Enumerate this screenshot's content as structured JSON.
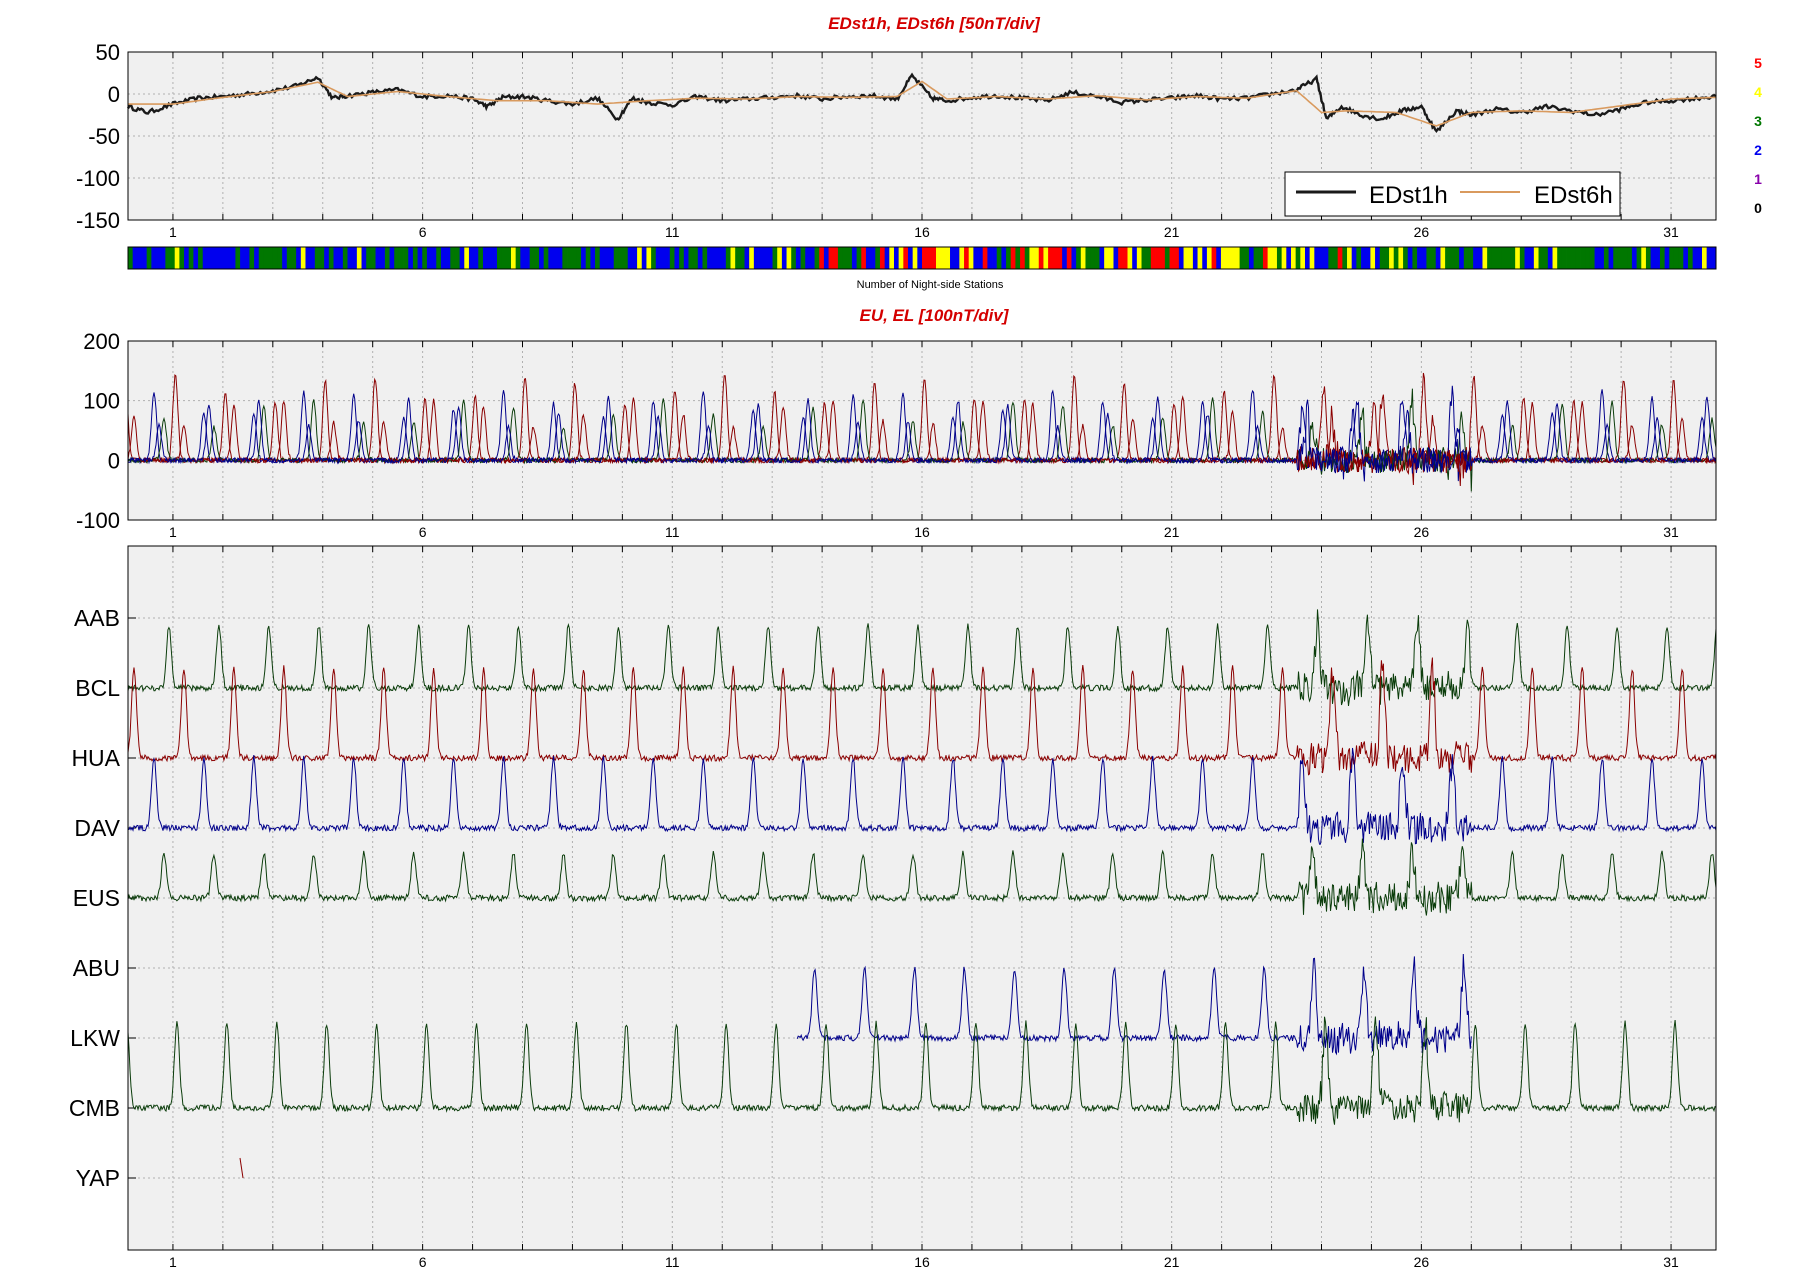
{
  "chart_data": [
    {
      "type": "line",
      "title": "EDst1h, EDst6h [50nT/div]",
      "ylim": [
        -150,
        50
      ],
      "yticks": [
        50,
        0,
        -50,
        -100,
        -150
      ],
      "xlim": [
        0.1,
        31.9
      ],
      "xticks": [
        1,
        6,
        11,
        16,
        21,
        26,
        31
      ],
      "grid": true,
      "legend": {
        "placement": "bottom-right",
        "entries": [
          "EDst1h",
          "EDst6h"
        ]
      },
      "series": [
        {
          "name": "EDst1h",
          "color": "#1a1a1a",
          "x": [
            0.1,
            0.5,
            1.0,
            1.5,
            2.0,
            2.5,
            3.0,
            3.5,
            3.9,
            4.2,
            4.5,
            5.0,
            5.5,
            6.0,
            6.5,
            7.0,
            7.3,
            7.6,
            8.0,
            8.5,
            9.0,
            9.5,
            9.9,
            10.2,
            10.5,
            11.0,
            11.5,
            12.0,
            12.5,
            13.0,
            13.5,
            14.0,
            14.5,
            15.0,
            15.5,
            15.8,
            16.2,
            16.5,
            17.0,
            17.5,
            18.0,
            18.5,
            19.0,
            19.5,
            20.0,
            20.5,
            21.0,
            21.5,
            22.0,
            22.5,
            23.0,
            23.5,
            23.9,
            24.1,
            24.4,
            24.8,
            25.2,
            25.6,
            26.0,
            26.3,
            26.7,
            27.0,
            27.5,
            28.0,
            28.5,
            29.0,
            29.5,
            30.0,
            30.5,
            31.0,
            31.5,
            31.9
          ],
          "y": [
            -15,
            -22,
            -12,
            -5,
            -3,
            0,
            4,
            10,
            20,
            -5,
            -2,
            2,
            5,
            -3,
            -2,
            -6,
            -15,
            -4,
            -3,
            -8,
            -12,
            -5,
            -30,
            -5,
            -10,
            -13,
            -3,
            -8,
            -6,
            -4,
            -2,
            -6,
            -3,
            -2,
            -6,
            22,
            -5,
            -8,
            -4,
            -2,
            -5,
            -8,
            2,
            -3,
            -10,
            -7,
            -5,
            -2,
            -6,
            -5,
            0,
            5,
            18,
            -30,
            -15,
            -25,
            -30,
            -20,
            -15,
            -45,
            -20,
            -25,
            -18,
            -22,
            -15,
            -20,
            -25,
            -18,
            -10,
            -8,
            -5,
            -3
          ]
        },
        {
          "name": "EDst6h",
          "color": "#d99a5e",
          "x": [
            0.1,
            1.0,
            2.0,
            3.0,
            3.9,
            4.5,
            5.5,
            6.5,
            7.5,
            8.5,
            9.5,
            10.5,
            11.5,
            12.5,
            13.5,
            14.5,
            15.5,
            16.0,
            16.5,
            17.5,
            18.5,
            19.5,
            20.5,
            21.5,
            22.5,
            23.5,
            24.0,
            24.5,
            25.5,
            26.3,
            27.0,
            28.0,
            29.0,
            30.0,
            31.0,
            31.9
          ],
          "y": [
            -12,
            -12,
            -4,
            3,
            14,
            -3,
            3,
            -3,
            -8,
            -8,
            -12,
            -8,
            -5,
            -6,
            -3,
            -4,
            -3,
            15,
            -6,
            -3,
            -6,
            -2,
            -7,
            -3,
            -5,
            4,
            -22,
            -20,
            -22,
            -38,
            -22,
            -20,
            -22,
            -14,
            -6,
            -4
          ]
        }
      ],
      "band": {
        "label": "Number of Night-side Stations",
        "key": [
          {
            "value": "5",
            "color": "#ff0000"
          },
          {
            "value": "4",
            "color": "#ffff00"
          },
          {
            "value": "3",
            "color": "#007700"
          },
          {
            "value": "2",
            "color": "#0000ee"
          },
          {
            "value": "1",
            "color": "#8800aa"
          },
          {
            "value": "0",
            "color": "#000000"
          }
        ]
      }
    },
    {
      "type": "line",
      "title": "EU, EL   [100nT/div]",
      "ylim": [
        -100,
        200
      ],
      "yticks": [
        200,
        100,
        0,
        -100
      ],
      "xlim": [
        0.1,
        31.9
      ],
      "xticks": [
        1,
        6,
        11,
        16,
        21,
        26,
        31
      ],
      "grid": true,
      "series_colors": [
        "#8b0000",
        "#00008b",
        "#0b3d0b"
      ]
    },
    {
      "type": "line",
      "title": "",
      "xlim": [
        0.1,
        31.9
      ],
      "xticks": [
        1,
        6,
        11,
        16,
        21,
        26,
        31
      ],
      "grid": true,
      "stations": [
        {
          "name": "AAB",
          "color": "#0b3d0b",
          "amplitude": 60
        },
        {
          "name": "BCL",
          "color": "#8b0000",
          "amplitude": 60
        },
        {
          "name": "HUA",
          "color": "#00008b",
          "amplitude": 60
        },
        {
          "name": "DAV",
          "color": "#0b3d0b",
          "amplitude": 40
        },
        {
          "name": "EUS",
          "color": "#00008b",
          "amplitude": 0
        },
        {
          "name": "ABU",
          "color": "#0b3d0b",
          "amplitude": 0
        },
        {
          "name": "LKW",
          "color": "#0b3d0b",
          "amplitude": 85
        },
        {
          "name": "CMB",
          "color": "#8b0000",
          "amplitude": 0
        },
        {
          "name": "YAP",
          "color": "#8b0000",
          "amplitude": 0
        }
      ]
    }
  ]
}
